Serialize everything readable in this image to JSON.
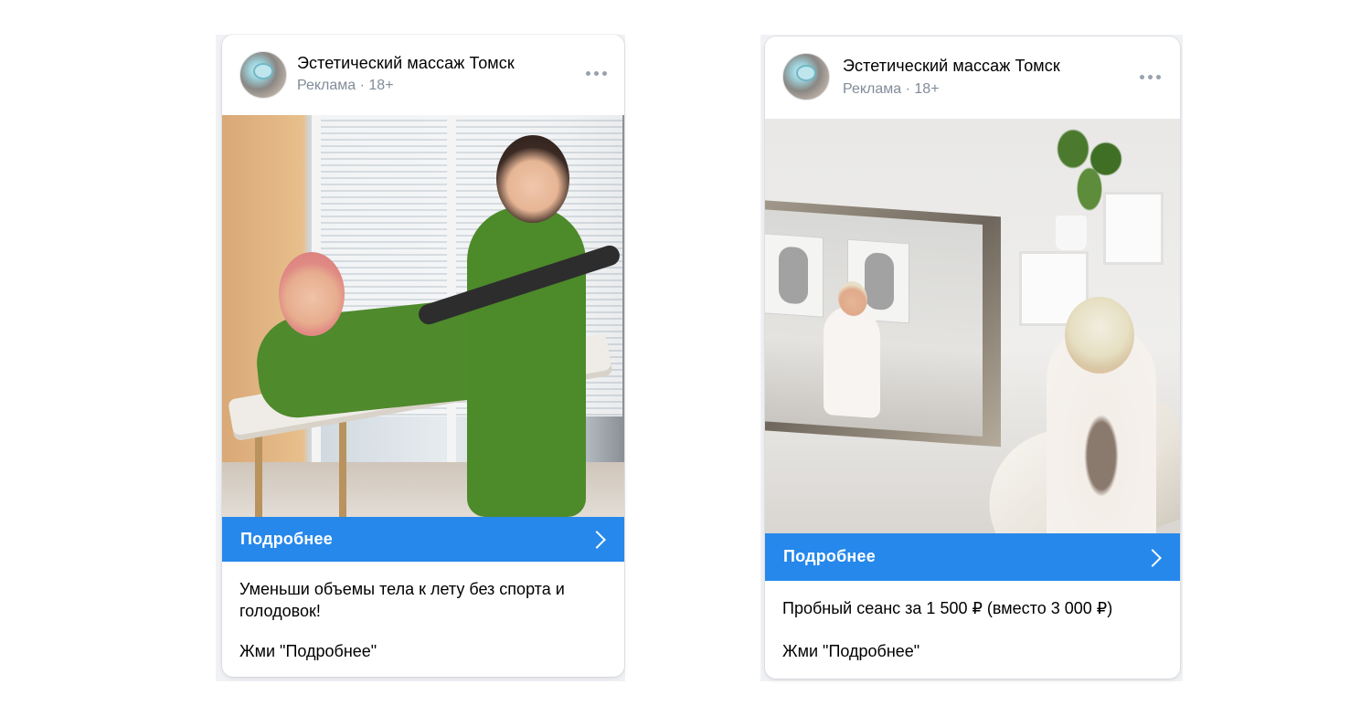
{
  "ads": [
    {
      "brand_name": "Эстетический массаж Томск",
      "meta": "Реклама · 18+",
      "cta_label": "Подробнее",
      "text_line1": "Уменьши объемы тела к лету без спорта и голодовок!",
      "text_line2": "Жми \"Подробнее\""
    },
    {
      "brand_name": "Эстетический массаж Томск",
      "meta": "Реклама · 18+",
      "cta_label": "Подробнее",
      "text_line1": "Пробный сеанс за 1 500 ₽ (вместо 3 000 ₽)",
      "text_line2": "Жми \"Подробнее\""
    }
  ],
  "colors": {
    "cta": "#2688eb",
    "meta": "#818c99",
    "card_bg": "#ffffff"
  },
  "icons": {
    "menu": "more-horizontal-icon",
    "cta_arrow": "chevron-right-icon"
  }
}
